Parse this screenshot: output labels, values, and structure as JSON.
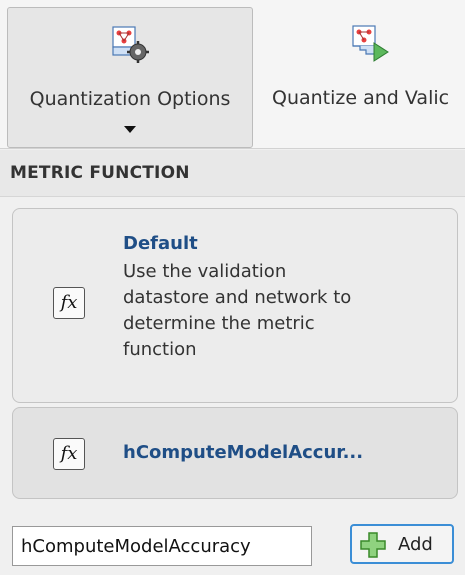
{
  "toolstrip": {
    "quantization_options_label": "Quantization Options",
    "quantize_validate_label": "Quantize and Valic"
  },
  "section": {
    "title": "METRIC FUNCTION"
  },
  "cards": {
    "default": {
      "title": "Default",
      "description": "Use the validation datastore and network to determine the metric function",
      "icon_text": "fx"
    },
    "custom": {
      "title": "hComputeModelAccur...",
      "icon_text": "fx"
    }
  },
  "footer": {
    "function_name_value": "hComputeModelAccuracy",
    "add_label": "Add"
  },
  "colors": {
    "accent_blue": "#1f4e86",
    "focus_border": "#3b8ed6",
    "add_icon_green": "#5cb85c"
  },
  "icons": {
    "quantization_options": "network-gear-icon",
    "quantize_validate": "network-play-icon",
    "dropdown": "caret-down-icon",
    "function": "fx-icon",
    "add": "plus-icon"
  }
}
